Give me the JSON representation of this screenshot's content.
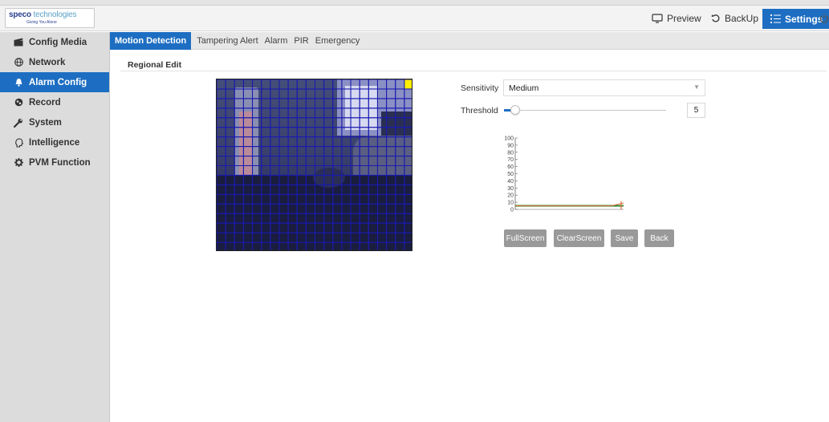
{
  "logo": {
    "brand_bold": "speco",
    "brand_light": "technologies",
    "tagline": "Giving You Alone"
  },
  "header": {
    "preview": "Preview",
    "backup": "BackUp",
    "settings": "Settings"
  },
  "sidebar": {
    "items": [
      {
        "label": "Config Media",
        "icon": "clapperboard-icon"
      },
      {
        "label": "Network",
        "icon": "globe-icon"
      },
      {
        "label": "Alarm Config",
        "icon": "bell-icon"
      },
      {
        "label": "Record",
        "icon": "record-icon"
      },
      {
        "label": "System",
        "icon": "wrench-icon"
      },
      {
        "label": "Intelligence",
        "icon": "head-icon"
      },
      {
        "label": "PVM Function",
        "icon": "gear-icon"
      }
    ],
    "active_index": 2
  },
  "tabs": {
    "items": [
      "Motion Detection",
      "Tampering Alert",
      "Alarm",
      "PIR",
      "Emergency"
    ],
    "active_index": 0
  },
  "section_title": "Regional Edit",
  "sensitivity": {
    "label": "Sensitivity",
    "value": "Medium"
  },
  "threshold": {
    "label": "Threshold",
    "value": "5",
    "slider_fraction": 0.05
  },
  "buttons": {
    "fullscreen": "FullScreen",
    "clearscreen": "ClearScreen",
    "save": "Save",
    "back": "Back"
  },
  "colors": {
    "accent": "#1d6ec2",
    "grid_line": "#1a1ab0",
    "selected_cell": "#ffee00",
    "chart_threshold": "#2a8a2a",
    "chart_level": "#e06a3a"
  },
  "chart_data": {
    "type": "line",
    "y_ticks": [
      "100",
      "90",
      "80",
      "70",
      "60",
      "50",
      "40",
      "30",
      "20",
      "10",
      "0"
    ],
    "ylim": [
      0,
      100
    ],
    "threshold": 5,
    "series": [
      {
        "values": [
          5,
          5,
          5,
          5,
          5,
          5,
          5,
          5,
          5,
          9
        ]
      }
    ]
  }
}
